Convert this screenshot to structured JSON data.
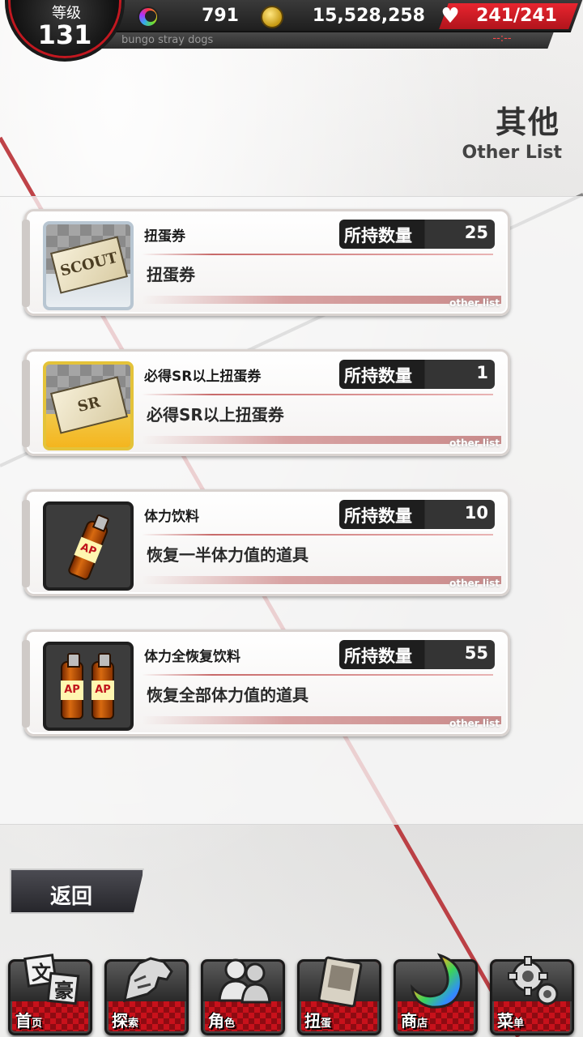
{
  "header": {
    "level_label": "等级",
    "level_value": "131",
    "subtitle": "bungo stray dogs",
    "stones": "791",
    "coins": "15,528,258",
    "ap": "241/241",
    "ap_timer": "--:--"
  },
  "page": {
    "title_zh": "其他",
    "title_en": "Other List"
  },
  "items": [
    {
      "name": "扭蛋券",
      "qty_label": "所持数量",
      "qty": "25",
      "desc": "扭蛋券",
      "tag": "other list",
      "icon": "scout-ticket-icon",
      "ticket_text": "SCOUT"
    },
    {
      "name": "必得SR以上扭蛋券",
      "qty_label": "所持数量",
      "qty": "1",
      "desc": "必得SR以上扭蛋券",
      "tag": "other list",
      "icon": "sr-ticket-icon",
      "ticket_text": "SR"
    },
    {
      "name": "体力饮料",
      "qty_label": "所持数量",
      "qty": "10",
      "desc": "恢复一半体力值的道具",
      "tag": "other list",
      "icon": "ap-drink-icon"
    },
    {
      "name": "体力全恢复饮料",
      "qty_label": "所持数量",
      "qty": "55",
      "desc": "恢复全部体力值的道具",
      "tag": "other list",
      "icon": "ap-drink-double-icon"
    }
  ],
  "back_label": "返回",
  "nav": [
    {
      "label": "首",
      "small": "页",
      "icon": "home-icon"
    },
    {
      "label": "探",
      "small": "索",
      "icon": "explore-icon"
    },
    {
      "label": "角",
      "small": "色",
      "icon": "character-icon"
    },
    {
      "label": "扭",
      "small": "蛋",
      "icon": "gacha-icon"
    },
    {
      "label": "商",
      "small": "店",
      "icon": "shop-icon"
    },
    {
      "label": "菜",
      "small": "单",
      "icon": "menu-gear-icon"
    }
  ],
  "colors": {
    "accent_red": "#c8111b",
    "dark": "#1e1e1e",
    "gold": "#e4c339"
  }
}
